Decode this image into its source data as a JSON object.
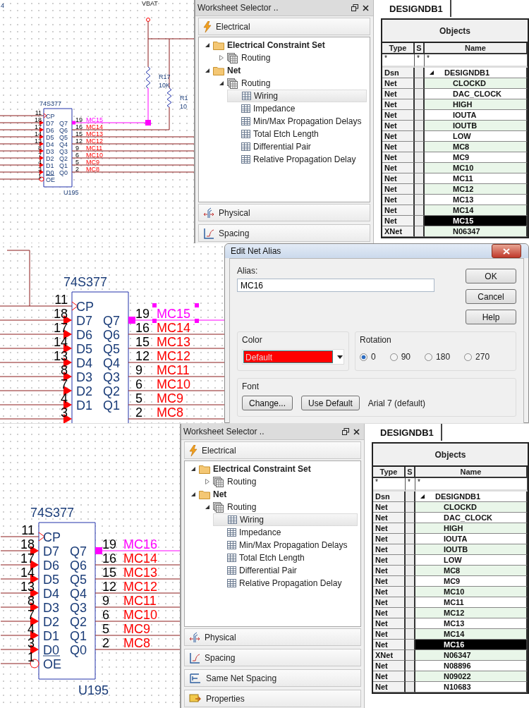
{
  "top_view": {
    "schematic": {
      "fragment_label": "4",
      "power_label": "VBAT",
      "resistors": [
        {
          "ref": "R17",
          "value": "10K"
        },
        {
          "ref": "R1",
          "value": "10"
        }
      ],
      "part": {
        "name": "74S377",
        "ref": "U195",
        "left_pins": [
          {
            "number": "11",
            "name": "CP",
            "kind": "clock"
          },
          {
            "number": "18",
            "name": "D7",
            "kind": "input"
          },
          {
            "number": "17",
            "name": "D6",
            "kind": "input"
          },
          {
            "number": "14",
            "name": "D5",
            "kind": "input"
          },
          {
            "number": "13",
            "name": "D4",
            "kind": "input"
          },
          {
            "number": "8",
            "name": "D3",
            "kind": "input"
          },
          {
            "number": "7",
            "name": "D2",
            "kind": "input"
          },
          {
            "number": "4",
            "name": "D1",
            "kind": "input"
          },
          {
            "number": "3",
            "name": "D0",
            "kind": "input"
          },
          {
            "number": "1",
            "name": "OE",
            "kind": "inverted"
          }
        ],
        "right_pins": [
          {
            "number": "19",
            "name": "Q7",
            "net": "MC15",
            "selected": true
          },
          {
            "number": "16",
            "name": "Q6",
            "net": "MC14",
            "selected": false
          },
          {
            "number": "15",
            "name": "Q5",
            "net": "MC13",
            "selected": false
          },
          {
            "number": "12",
            "name": "Q4",
            "net": "MC12",
            "selected": false
          },
          {
            "number": "9",
            "name": "Q3",
            "net": "MC11",
            "selected": false
          },
          {
            "number": "6",
            "name": "Q2",
            "net": "MC10",
            "selected": false
          },
          {
            "number": "5",
            "name": "Q1",
            "net": "MC9",
            "selected": false
          },
          {
            "number": "2",
            "name": "Q0",
            "net": "MC8",
            "selected": false
          }
        ]
      }
    },
    "worksheet_selector": {
      "title": "Worksheet Selector ..",
      "sections_before": [
        {
          "label": "Electrical",
          "kind": "electrical"
        }
      ],
      "tree": [
        {
          "label": "Electrical Constraint Set",
          "kind": "folder",
          "expanded": true,
          "children": [
            {
              "label": "Routing",
              "kind": "group",
              "expanded": false
            }
          ]
        },
        {
          "label": "Net",
          "kind": "folder",
          "expanded": true,
          "children": [
            {
              "label": "Routing",
              "kind": "group",
              "expanded": true,
              "children": [
                {
                  "label": "Wiring",
                  "kind": "sheet",
                  "selected": true
                },
                {
                  "label": "Impedance",
                  "kind": "sheet",
                  "selected": false
                },
                {
                  "label": "Min/Max Propagation Delays",
                  "kind": "sheet",
                  "selected": false
                },
                {
                  "label": "Total Etch Length",
                  "kind": "sheet",
                  "selected": false
                },
                {
                  "label": "Differential Pair",
                  "kind": "sheet",
                  "selected": false
                },
                {
                  "label": "Relative Propagation Delay",
                  "kind": "sheet",
                  "selected": false
                }
              ]
            }
          ]
        }
      ],
      "sections_after": [
        {
          "label": "Physical",
          "kind": "physical"
        },
        {
          "label": "Spacing",
          "kind": "spacing"
        }
      ]
    },
    "objects_table": {
      "tab": "DESIGNDB1",
      "title": "Objects",
      "columns": [
        "Type",
        "S",
        "Name"
      ],
      "filters": [
        "*",
        "*",
        "*"
      ],
      "rows": [
        {
          "type": "Dsn",
          "name": "DESIGNDB1",
          "kind": "design",
          "selected": false
        },
        {
          "type": "Net",
          "name": "CLOCKD",
          "kind": "net",
          "selected": false
        },
        {
          "type": "Net",
          "name": "DAC_CLOCK",
          "kind": "net",
          "selected": false
        },
        {
          "type": "Net",
          "name": "HIGH",
          "kind": "net",
          "selected": false
        },
        {
          "type": "Net",
          "name": "IOUTA",
          "kind": "net",
          "selected": false
        },
        {
          "type": "Net",
          "name": "IOUTB",
          "kind": "net",
          "selected": false
        },
        {
          "type": "Net",
          "name": "LOW",
          "kind": "net",
          "selected": false
        },
        {
          "type": "Net",
          "name": "MC8",
          "kind": "net",
          "selected": false
        },
        {
          "type": "Net",
          "name": "MC9",
          "kind": "net",
          "selected": false
        },
        {
          "type": "Net",
          "name": "MC10",
          "kind": "net",
          "selected": false
        },
        {
          "type": "Net",
          "name": "MC11",
          "kind": "net",
          "selected": false
        },
        {
          "type": "Net",
          "name": "MC12",
          "kind": "net",
          "selected": false
        },
        {
          "type": "Net",
          "name": "MC13",
          "kind": "net",
          "selected": false
        },
        {
          "type": "Net",
          "name": "MC14",
          "kind": "net",
          "selected": false
        },
        {
          "type": "Net",
          "name": "MC15",
          "kind": "net",
          "selected": true
        },
        {
          "type": "XNet",
          "name": "N06347",
          "kind": "net",
          "selected": false
        }
      ]
    }
  },
  "dialog_view": {
    "schematic": {
      "part": {
        "name": "74S377",
        "left_pins": [
          {
            "number": "11",
            "name": "CP",
            "kind": "clock"
          },
          {
            "number": "18",
            "name": "D7",
            "kind": "input"
          },
          {
            "number": "17",
            "name": "D6",
            "kind": "input"
          },
          {
            "number": "14",
            "name": "D5",
            "kind": "input"
          },
          {
            "number": "13",
            "name": "D4",
            "kind": "input"
          },
          {
            "number": "8",
            "name": "D3",
            "kind": "input"
          },
          {
            "number": "7",
            "name": "D2",
            "kind": "input"
          },
          {
            "number": "4",
            "name": "D1",
            "kind": "input"
          },
          {
            "number": "3",
            "kind": "input"
          }
        ],
        "right_pins": [
          {
            "number": "19",
            "name": "Q7",
            "net": "MC15",
            "selected": true,
            "label_handles": true
          },
          {
            "number": "16",
            "name": "Q6",
            "net": "MC14",
            "selected": false
          },
          {
            "number": "15",
            "name": "Q5",
            "net": "MC13",
            "selected": false
          },
          {
            "number": "12",
            "name": "Q4",
            "net": "MC12",
            "selected": false
          },
          {
            "number": "9",
            "name": "Q3",
            "net": "MC11",
            "selected": false
          },
          {
            "number": "6",
            "name": "Q2",
            "net": "MC10",
            "selected": false
          },
          {
            "number": "5",
            "name": "Q1",
            "net": "MC9",
            "selected": false
          },
          {
            "number": "2",
            "net": "MC8",
            "selected": false
          }
        ]
      }
    },
    "dialog": {
      "title": "Edit Net Alias",
      "alias_label": "Alias:",
      "alias_value": "MC16",
      "buttons": [
        "OK",
        "Cancel",
        "Help"
      ],
      "color_group": {
        "label": "Color",
        "value": "Default"
      },
      "rotation_group": {
        "label": "Rotation",
        "options": [
          {
            "label": "0",
            "selected": true
          },
          {
            "label": "90",
            "selected": false
          },
          {
            "label": "180",
            "selected": false
          },
          {
            "label": "270",
            "selected": false
          }
        ]
      },
      "font_group": {
        "label": "Font",
        "buttons": [
          "Change...",
          "Use Default"
        ],
        "current": "Arial 7 (default)"
      }
    }
  },
  "bottom_view": {
    "schematic": {
      "part": {
        "name": "74S377",
        "ref": "U195",
        "left_pins": [
          {
            "number": "11",
            "name": "CP",
            "kind": "clock"
          },
          {
            "number": "18",
            "name": "D7",
            "kind": "input"
          },
          {
            "number": "17",
            "name": "D6",
            "kind": "input"
          },
          {
            "number": "14",
            "name": "D5",
            "kind": "input"
          },
          {
            "number": "13",
            "name": "D4",
            "kind": "input"
          },
          {
            "number": "8",
            "name": "D3",
            "kind": "input"
          },
          {
            "number": "7",
            "name": "D2",
            "kind": "input"
          },
          {
            "number": "4",
            "name": "D1",
            "kind": "input"
          },
          {
            "number": "3",
            "name": "D0",
            "kind": "input"
          },
          {
            "number": "1",
            "name": "OE",
            "kind": "inverted"
          }
        ],
        "right_pins": [
          {
            "number": "19",
            "name": "Q7",
            "net": "MC16",
            "selected": true
          },
          {
            "number": "16",
            "name": "Q6",
            "net": "MC14",
            "selected": false
          },
          {
            "number": "15",
            "name": "Q5",
            "net": "MC13",
            "selected": false
          },
          {
            "number": "12",
            "name": "Q4",
            "net": "MC12",
            "selected": false
          },
          {
            "number": "9",
            "name": "Q3",
            "net": "MC11",
            "selected": false
          },
          {
            "number": "6",
            "name": "Q2",
            "net": "MC10",
            "selected": false
          },
          {
            "number": "5",
            "name": "Q1",
            "net": "MC9",
            "selected": false
          },
          {
            "number": "2",
            "name": "Q0",
            "net": "MC8",
            "selected": false
          }
        ]
      }
    },
    "worksheet_selector": {
      "title": "Worksheet Selector ..",
      "sections_before": [
        {
          "label": "Electrical",
          "kind": "electrical"
        }
      ],
      "tree": [
        {
          "label": "Electrical Constraint Set",
          "kind": "folder",
          "expanded": true,
          "children": [
            {
              "label": "Routing",
              "kind": "group",
              "expanded": false
            }
          ]
        },
        {
          "label": "Net",
          "kind": "folder",
          "expanded": true,
          "children": [
            {
              "label": "Routing",
              "kind": "group",
              "expanded": true,
              "children": [
                {
                  "label": "Wiring",
                  "kind": "sheet",
                  "selected": true
                },
                {
                  "label": "Impedance",
                  "kind": "sheet",
                  "selected": false
                },
                {
                  "label": "Min/Max Propagation Delays",
                  "kind": "sheet",
                  "selected": false
                },
                {
                  "label": "Total Etch Length",
                  "kind": "sheet",
                  "selected": false
                },
                {
                  "label": "Differential Pair",
                  "kind": "sheet",
                  "selected": false
                },
                {
                  "label": "Relative Propagation Delay",
                  "kind": "sheet",
                  "selected": false
                }
              ]
            }
          ]
        }
      ],
      "sections_after": [
        {
          "label": "Physical",
          "kind": "physical"
        },
        {
          "label": "Spacing",
          "kind": "spacing"
        },
        {
          "label": "Same Net Spacing",
          "kind": "same_net_spacing"
        },
        {
          "label": "Properties",
          "kind": "properties"
        }
      ]
    },
    "objects_table": {
      "tab": "DESIGNDB1",
      "title": "Objects",
      "columns": [
        "Type",
        "S",
        "Name"
      ],
      "filters": [
        "*",
        "*",
        "*"
      ],
      "rows": [
        {
          "type": "Dsn",
          "name": "DESIGNDB1",
          "kind": "design",
          "selected": false
        },
        {
          "type": "Net",
          "name": "CLOCKD",
          "kind": "net",
          "selected": false
        },
        {
          "type": "Net",
          "name": "DAC_CLOCK",
          "kind": "net",
          "selected": false
        },
        {
          "type": "Net",
          "name": "HIGH",
          "kind": "net",
          "selected": false
        },
        {
          "type": "Net",
          "name": "IOUTA",
          "kind": "net",
          "selected": false
        },
        {
          "type": "Net",
          "name": "IOUTB",
          "kind": "net",
          "selected": false
        },
        {
          "type": "Net",
          "name": "LOW",
          "kind": "net",
          "selected": false
        },
        {
          "type": "Net",
          "name": "MC8",
          "kind": "net",
          "selected": false
        },
        {
          "type": "Net",
          "name": "MC9",
          "kind": "net",
          "selected": false
        },
        {
          "type": "Net",
          "name": "MC10",
          "kind": "net",
          "selected": false
        },
        {
          "type": "Net",
          "name": "MC11",
          "kind": "net",
          "selected": false
        },
        {
          "type": "Net",
          "name": "MC12",
          "kind": "net",
          "selected": false
        },
        {
          "type": "Net",
          "name": "MC13",
          "kind": "net",
          "selected": false
        },
        {
          "type": "Net",
          "name": "MC14",
          "kind": "net",
          "selected": false
        },
        {
          "type": "Net",
          "name": "MC16",
          "kind": "net",
          "selected": true
        },
        {
          "type": "XNet",
          "name": "N06347",
          "kind": "net",
          "selected": false
        },
        {
          "type": "Net",
          "name": "N08896",
          "kind": "net",
          "selected": false
        },
        {
          "type": "Net",
          "name": "N09022",
          "kind": "net",
          "selected": false
        },
        {
          "type": "Net",
          "name": "N10683",
          "kind": "net",
          "selected": false
        }
      ]
    }
  }
}
